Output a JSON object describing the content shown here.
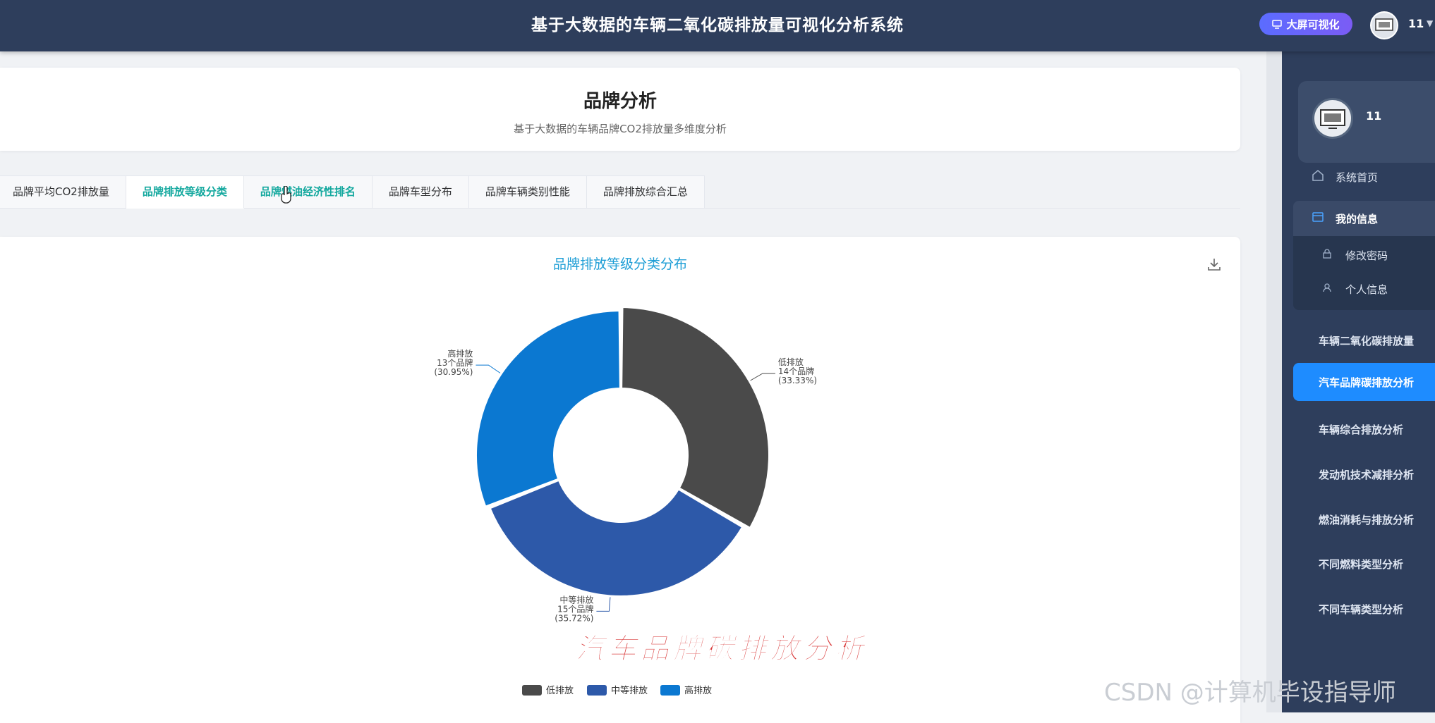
{
  "app": {
    "title": "基于大数据的车辆二氧化碳排放量可视化分析系统",
    "bigscreen_label": "大屏可视化",
    "user_name": "11"
  },
  "sidebar": {
    "user_name": "11",
    "items": [
      {
        "label": "系统首页",
        "icon": "home-icon"
      },
      {
        "label": "我的信息",
        "icon": "card-icon"
      },
      {
        "label": "车辆二氧化碳排放量"
      },
      {
        "label": "汽车品牌碳排放分析",
        "active": true
      },
      {
        "label": "车辆综合排放分析"
      },
      {
        "label": "发动机技术减排分析"
      },
      {
        "label": "燃油消耗与排放分析"
      },
      {
        "label": "不同燃料类型分析"
      },
      {
        "label": "不同车辆类型分析"
      }
    ],
    "subitems": [
      {
        "label": "修改密码",
        "icon": "lock-icon"
      },
      {
        "label": "个人信息",
        "icon": "user-icon"
      }
    ]
  },
  "page": {
    "title": "品牌分析",
    "subtitle": "基于大数据的车辆品牌CO2排放量多维度分析"
  },
  "tabs": [
    {
      "label": "品牌平均CO2排放量"
    },
    {
      "label": "品牌排放等级分类",
      "active": true
    },
    {
      "label": "品牌燃油经济性排名",
      "hover": true
    },
    {
      "label": "品牌车型分布"
    },
    {
      "label": "品牌车辆类别性能"
    },
    {
      "label": "品牌排放综合汇总"
    }
  ],
  "chart_data": {
    "type": "pie",
    "title": "品牌排放等级分类分布",
    "slices": [
      {
        "name": "低排放",
        "count_label": "14个品牌",
        "percent_label": "(33.33%)",
        "value": 14,
        "color": "#4a4a4a"
      },
      {
        "name": "中等排放",
        "count_label": "15个品牌",
        "percent_label": "(35.72%)",
        "value": 15,
        "color": "#2d59a9"
      },
      {
        "name": "高排放",
        "count_label": "13个品牌",
        "percent_label": "(30.95%)",
        "value": 13,
        "color": "#0b78d1"
      }
    ],
    "legend_position": "bottom-center"
  },
  "overlay": {
    "watermark": "汽车品牌碳排放分析",
    "csdn": "CSDN @计算机毕设指导师"
  },
  "colors": {
    "topbar": "#2e3e5c",
    "accent_tab": "#13a89e",
    "menu_active": "#1e8cff",
    "chart_title": "#1e9ed6"
  }
}
